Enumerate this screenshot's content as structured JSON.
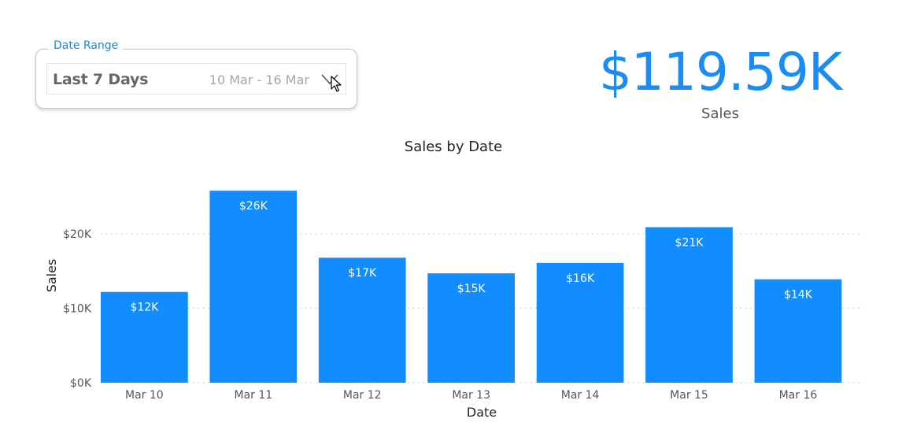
{
  "slicer": {
    "label": "Date Range",
    "value": "Last 7 Days",
    "range": "10 Mar - 16 Mar",
    "chevron_icon": "chevron-down-icon",
    "cursor_icon": "pointer-cursor-icon"
  },
  "kpi": {
    "value": "$119.59K",
    "label": "Sales",
    "color": "#1a8cf2"
  },
  "chart_data": {
    "type": "bar",
    "title": "Sales by Date",
    "xlabel": "Date",
    "ylabel": "Sales",
    "categories": [
      "Mar 10",
      "Mar 11",
      "Mar 12",
      "Mar 13",
      "Mar 14",
      "Mar 15",
      "Mar 16"
    ],
    "values": [
      12200,
      25800,
      16800,
      14700,
      16100,
      20900,
      13900
    ],
    "data_labels": [
      "$12K",
      "$26K",
      "$17K",
      "$15K",
      "$16K",
      "$21K",
      "$14K"
    ],
    "ylim": [
      0,
      20000
    ],
    "yticks": [
      0,
      10000,
      20000
    ],
    "ytick_labels": [
      "$0K",
      "$10K",
      "$20K"
    ],
    "grid": true,
    "bar_color": "#118dff"
  }
}
